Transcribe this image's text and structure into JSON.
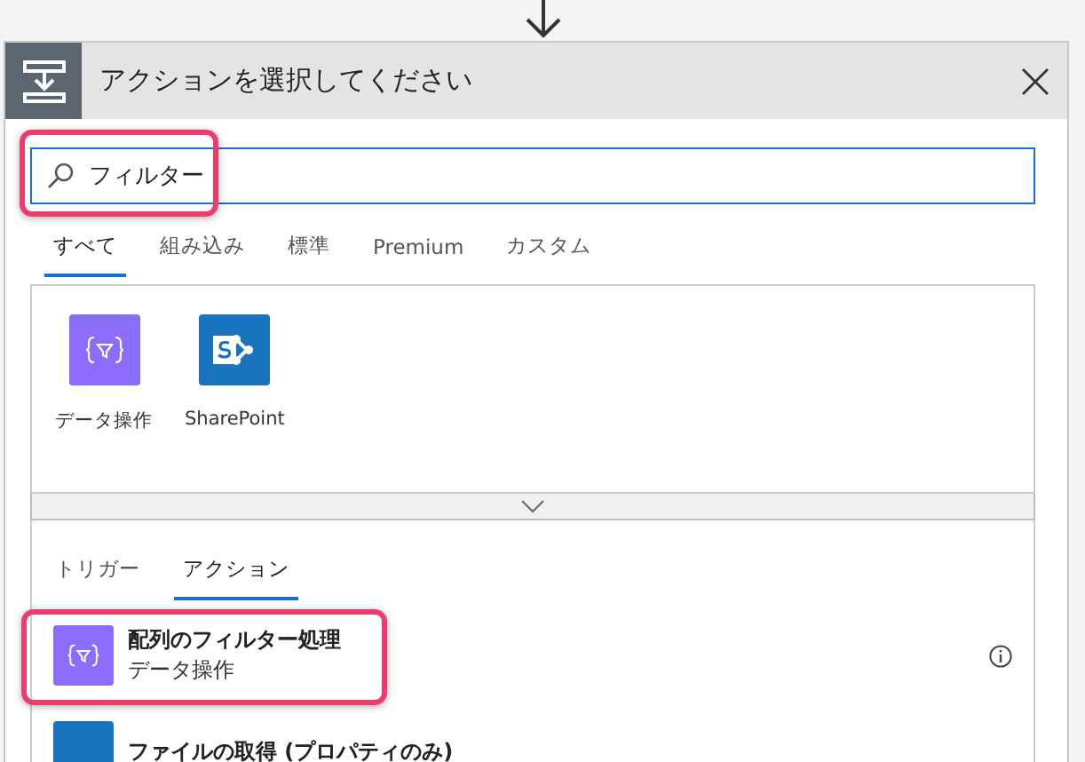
{
  "dialog": {
    "title": "アクションを選択してください"
  },
  "search": {
    "value": "フィルター",
    "highlighted": true
  },
  "category_tabs": [
    {
      "label": "すべて",
      "selected": true
    },
    {
      "label": "組み込み",
      "selected": false
    },
    {
      "label": "標準",
      "selected": false
    },
    {
      "label": "Premium",
      "selected": false
    },
    {
      "label": "カスタム",
      "selected": false
    }
  ],
  "connectors": [
    {
      "label": "データ操作",
      "kind": "data"
    },
    {
      "label": "SharePoint",
      "kind": "sharepoint"
    }
  ],
  "result_tabs": [
    {
      "label": "トリガー",
      "selected": false
    },
    {
      "label": "アクション",
      "selected": true
    }
  ],
  "results": [
    {
      "title": "配列のフィルター処理",
      "subtitle": "データ操作",
      "kind": "data",
      "highlighted": true,
      "info": true
    },
    {
      "title": "ファイルの取得 (プロパティのみ)",
      "kind": "sharepoint",
      "highlighted": false,
      "info": false
    }
  ]
}
